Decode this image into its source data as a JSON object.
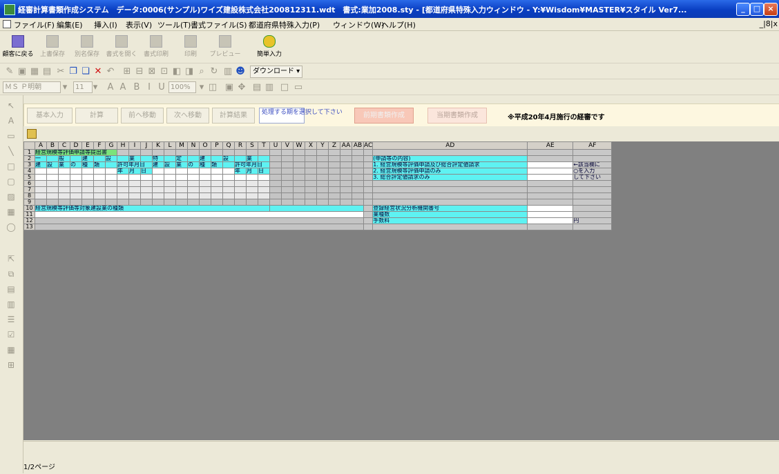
{
  "window": {
    "title": "経審計算書類作成システム　データ:0006(サンプル)ワイズ建設株式会社200812311.wdt　書式:業加2008.sty - [都道府県特殊入力ウィンドウ - Y:¥Wisdom¥MASTER¥スタイル Ver7..."
  },
  "menu": {
    "items": [
      "ファイル(F)",
      "編集(E)",
      "挿入(I)",
      "表示(V)",
      "ツール(T)",
      "書式ファイル(S)",
      "都道府県特殊入力(P)",
      "ウィンドウ(W)",
      "ヘルプ(H)"
    ],
    "right": "_|8|x"
  },
  "toolbar": {
    "back_label": "顧客に戻る",
    "buttons": [
      "上書保存",
      "別名保存",
      "書式を開く",
      "書式印刷",
      "印刷",
      "プレビュー"
    ],
    "easy_label": "簡単入力",
    "download_label": "ダウンロード",
    "font_name": "ＭＳ Ｐ明朝",
    "font_size": "11",
    "zoom": "100%"
  },
  "actionbar": {
    "buttons": [
      "基本入力",
      "計算",
      "前ヘ移動",
      "次へ移動",
      "計算結果"
    ],
    "hint": "処理する期を選択して下さい",
    "pink1": "前期書類作成",
    "pink2": "当期書類作成",
    "notice": "※平成20年4月施行の経審です"
  },
  "sheet": {
    "columns": [
      "A",
      "B",
      "C",
      "D",
      "E",
      "F",
      "G",
      "H",
      "I",
      "J",
      "K",
      "L",
      "M",
      "N",
      "O",
      "P",
      "Q",
      "R",
      "S",
      "T",
      "U",
      "V",
      "W",
      "X",
      "Y",
      "Z",
      "AA",
      "AB",
      "AC",
      "AD",
      "AE",
      "AF"
    ],
    "rows": [
      "1",
      "2",
      "3",
      "4",
      "5",
      "6",
      "7",
      "8",
      "9",
      "10",
      "11",
      "12",
      "13"
    ],
    "r1_title": "経営規模等評価申請等提出書",
    "r2": [
      "一",
      "般",
      "建",
      "設",
      "業",
      "特",
      "定",
      "建",
      "設",
      "業"
    ],
    "r3": [
      "建",
      "設",
      "業",
      "の",
      "種",
      "類",
      "許可年月日",
      "建",
      "設",
      "業",
      "の",
      "種",
      "類",
      "許可年月日"
    ],
    "r4": [
      "年",
      "月",
      "日",
      "年",
      "月",
      "日"
    ],
    "r10_title": "経営規模等評価等対象建設業の種類",
    "ad": {
      "r2": "(申請等の内容)",
      "r3": "1. 経営規模等評価申請及び総合評定値請求",
      "r4": "2. 経営規模等評価申請のみ",
      "r5": "3. 総合評定値請求のみ",
      "r10": "登録経営状況分析機関番号",
      "r11": "業種数",
      "r12": "手数料"
    },
    "af": {
      "r3": "←該当欄に",
      "r4": "○を入力",
      "r5": "して下さい",
      "r12": "円"
    }
  },
  "status": {
    "page": "1/2ページ"
  }
}
